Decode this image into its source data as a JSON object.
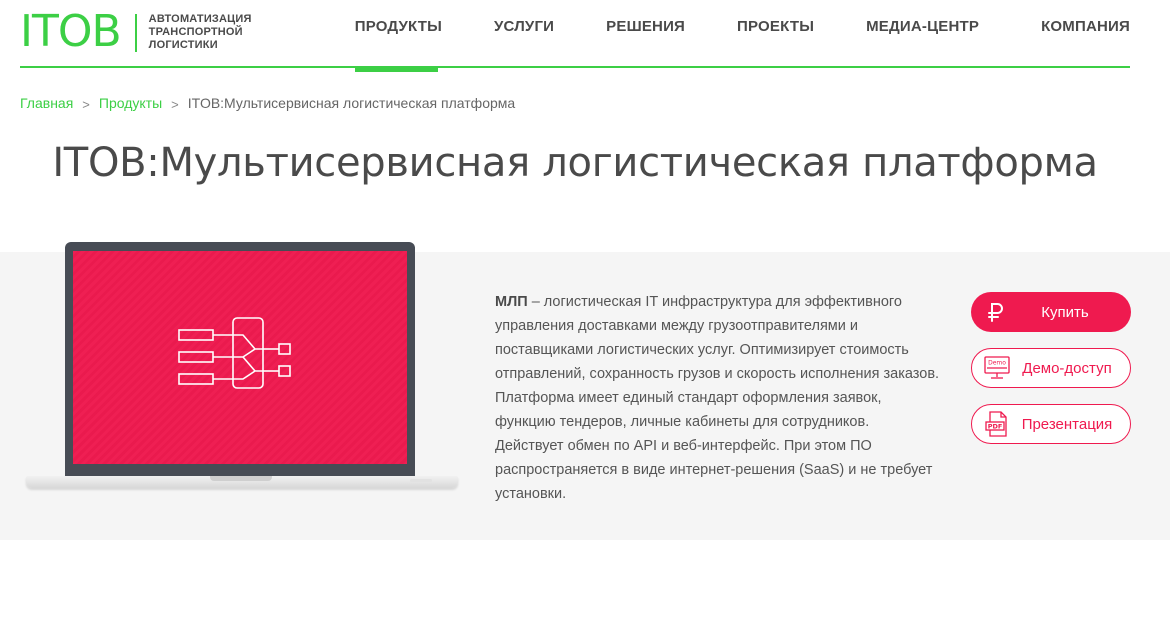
{
  "logo": {
    "mark": "ITOB",
    "tagline": [
      "АВТОМАТИЗАЦИЯ",
      "ТРАНСПОРТНОЙ",
      "ЛОГИСТИКИ"
    ]
  },
  "nav": {
    "items": [
      {
        "label": "ПРОДУКТЫ",
        "active": true
      },
      {
        "label": "УСЛУГИ",
        "active": false
      },
      {
        "label": "РЕШЕНИЯ",
        "active": false
      },
      {
        "label": "ПРОЕКТЫ",
        "active": false
      },
      {
        "label": "МЕДИА-ЦЕНТР",
        "active": false
      },
      {
        "label": "КОМПАНИЯ",
        "active": false
      }
    ]
  },
  "breadcrumb": {
    "home": "Главная",
    "section": "Продукты",
    "separator": ">",
    "current": "ITOB:Мультисервисная логистическая платформа"
  },
  "page": {
    "title": "ITOB:Мультисервисная логистическая платформа"
  },
  "product": {
    "lead": "МЛП",
    "description": " – логистическая IT инфраструктура для эффективного управления доставками между грузоотправителями и поставщиками логистических услуг. Оптимизирует стоимость отправлений, сохранность грузов и скорость исполнения заказов. Платформа имеет единый стандарт оформления заявок, функцию тендеров, личные кабинеты для сотрудников. Действует обмен по API и веб-интерфейс. При этом ПО распространяется в виде интернет-решения (SaaS) и не требует установки."
  },
  "actions": {
    "buy": {
      "label": "Купить",
      "icon": "ruble-icon"
    },
    "demo": {
      "label": "Демо-доступ",
      "icon": "demo-monitor-icon",
      "icon_text": "Demo"
    },
    "presentation": {
      "label": "Презентация",
      "icon": "pdf-document-icon",
      "icon_text": "PDF"
    }
  },
  "colors": {
    "brand_green": "#3ccf45",
    "accent_red": "#ef1a4f",
    "text": "#4a4a4a",
    "band_bg": "#f5f5f5"
  }
}
